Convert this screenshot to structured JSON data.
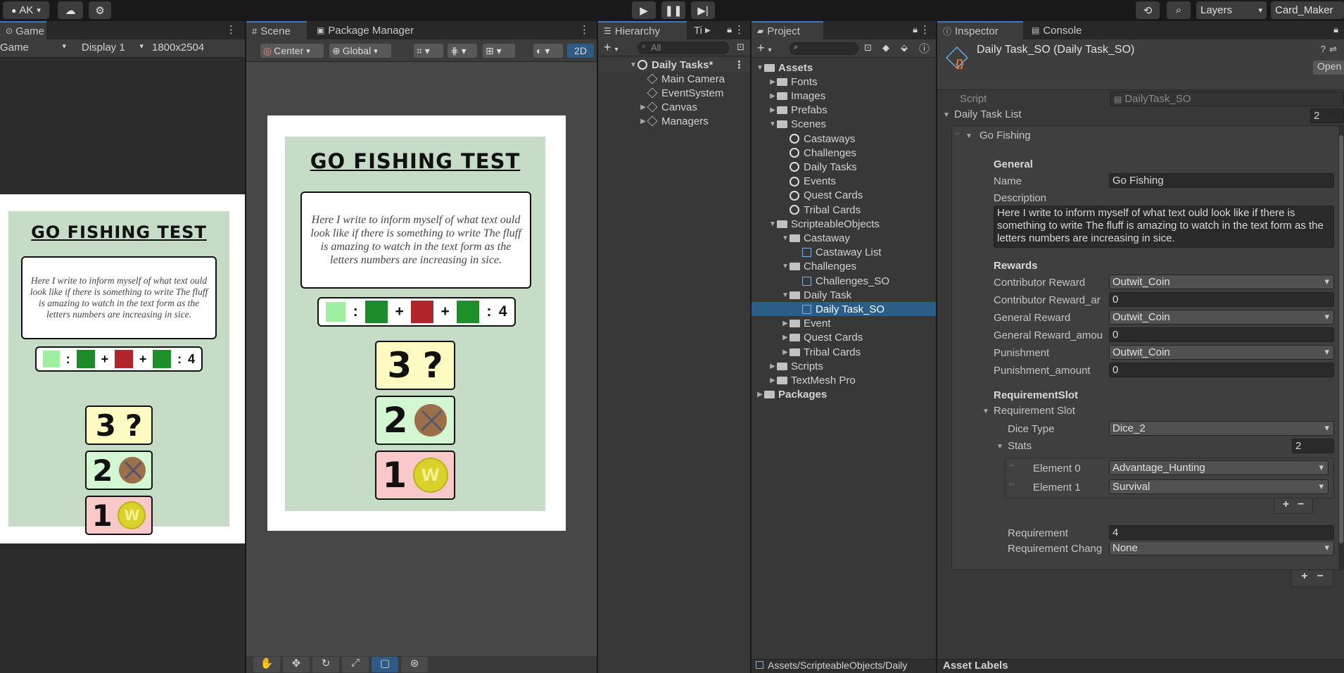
{
  "topbar": {
    "account": "AK",
    "layers_label": "Layers",
    "layout_label": "Card_Maker"
  },
  "game": {
    "tab": "Game",
    "mode": "Game",
    "display": "Display 1",
    "resolution": "1800x2504"
  },
  "scene": {
    "tab_scene": "Scene",
    "tab_package": "Package Manager",
    "pivot": "Center",
    "space": "Global",
    "mode_2d": "2D"
  },
  "card": {
    "title": "GO FISHING TEST",
    "description": "Here I write to inform myself of what text ould look like if there is something to write The fluff is amazing to watch in the text form as the letters numbers are increasing in sice.",
    "dice_sep": ":",
    "plus": "+",
    "requirement": "4",
    "rewards": [
      {
        "num": "3",
        "sym": "?",
        "color": "#fdfac2"
      },
      {
        "num": "2",
        "sym": "x-coin",
        "color": "#d3f6d3"
      },
      {
        "num": "1",
        "sym": "W",
        "color": "#f9c8c8"
      }
    ]
  },
  "hierarchy": {
    "tab": "Hierarchy",
    "tab2": "Ti",
    "search_placeholder": "All",
    "scene_name": "Daily Tasks*",
    "items": [
      {
        "label": "Main Camera",
        "expandable": false
      },
      {
        "label": "EventSystem",
        "expandable": false
      },
      {
        "label": "Canvas",
        "expandable": true
      },
      {
        "label": "Managers",
        "expandable": true
      }
    ]
  },
  "project": {
    "tab": "Project",
    "rows": [
      {
        "label": "Assets",
        "depth": 0,
        "open": true,
        "icon": "folder",
        "bold": true
      },
      {
        "label": "Fonts",
        "depth": 1,
        "open": false,
        "icon": "folder"
      },
      {
        "label": "Images",
        "depth": 1,
        "open": false,
        "icon": "folder"
      },
      {
        "label": "Prefabs",
        "depth": 1,
        "open": false,
        "icon": "folder"
      },
      {
        "label": "Scenes",
        "depth": 1,
        "open": true,
        "icon": "folder"
      },
      {
        "label": "Castaways",
        "depth": 2,
        "icon": "unity"
      },
      {
        "label": "Challenges",
        "depth": 2,
        "icon": "unity"
      },
      {
        "label": "Daily Tasks",
        "depth": 2,
        "icon": "unity"
      },
      {
        "label": "Events",
        "depth": 2,
        "icon": "unity"
      },
      {
        "label": "Quest Cards",
        "depth": 2,
        "icon": "unity"
      },
      {
        "label": "Tribal Cards",
        "depth": 2,
        "icon": "unity"
      },
      {
        "label": "ScripteableObjects",
        "depth": 1,
        "open": true,
        "icon": "folder"
      },
      {
        "label": "Castaway",
        "depth": 2,
        "open": true,
        "icon": "folder"
      },
      {
        "label": "Castaway List",
        "depth": 3,
        "icon": "so"
      },
      {
        "label": "Challenges",
        "depth": 2,
        "open": true,
        "icon": "folder"
      },
      {
        "label": "Challenges_SO",
        "depth": 3,
        "icon": "so"
      },
      {
        "label": "Daily Task",
        "depth": 2,
        "open": true,
        "icon": "folder"
      },
      {
        "label": "Daily Task_SO",
        "depth": 3,
        "icon": "so",
        "selected": true
      },
      {
        "label": "Event",
        "depth": 2,
        "open": false,
        "icon": "folder"
      },
      {
        "label": "Quest Cards",
        "depth": 2,
        "open": false,
        "icon": "folder"
      },
      {
        "label": "Tribal Cards",
        "depth": 2,
        "open": false,
        "icon": "folder"
      },
      {
        "label": "Scripts",
        "depth": 1,
        "open": false,
        "icon": "folder"
      },
      {
        "label": "TextMesh Pro",
        "depth": 1,
        "open": false,
        "icon": "folder"
      },
      {
        "label": "Packages",
        "depth": 0,
        "open": false,
        "icon": "folder",
        "bold": true
      }
    ],
    "footer_path": "Assets/ScripteableObjects/Daily"
  },
  "inspector": {
    "tab": "Inspector",
    "tab_console": "Console",
    "object_title": "Daily Task_SO (Daily Task_SO)",
    "open_button": "Open",
    "script_label": "Script",
    "script_value": "DailyTask_SO",
    "list_label": "Daily Task List",
    "list_count": "2",
    "element_name": "Go Fishing",
    "general_header": "General",
    "name_label": "Name",
    "name_value": "Go Fishing",
    "desc_label": "Description",
    "desc_value": "Here I write to inform myself of what text ould look like if there is something to write The fluff is amazing to watch in the text form as the letters numbers are increasing in sice.",
    "rewards_header": "Rewards",
    "contrib_reward_label": "Contributor Reward",
    "contrib_reward_value": "Outwit_Coin",
    "contrib_amount_label": "Contributor Reward_ar",
    "contrib_amount_value": "0",
    "general_reward_label": "General Reward",
    "general_reward_value": "Outwit_Coin",
    "general_amount_label": "General Reward_amou",
    "general_amount_value": "0",
    "punishment_label": "Punishment",
    "punishment_value": "Outwit_Coin",
    "punishment_amount_label": "Punishment_amount",
    "punishment_amount_value": "0",
    "reqslot_header": "RequirementSlot",
    "reqslot_label": "Requirement Slot",
    "dice_type_label": "Dice Type",
    "dice_type_value": "Dice_2",
    "stats_label": "Stats",
    "stats_count": "2",
    "element0_label": "Element 0",
    "element0_value": "Advantage_Hunting",
    "element1_label": "Element 1",
    "element1_value": "Survival",
    "requirement_label": "Requirement",
    "requirement_value": "4",
    "req_change_label": "Requirement Chang",
    "req_change_value": "None",
    "plus": "+",
    "minus": "−",
    "asset_labels": "Asset Labels"
  }
}
